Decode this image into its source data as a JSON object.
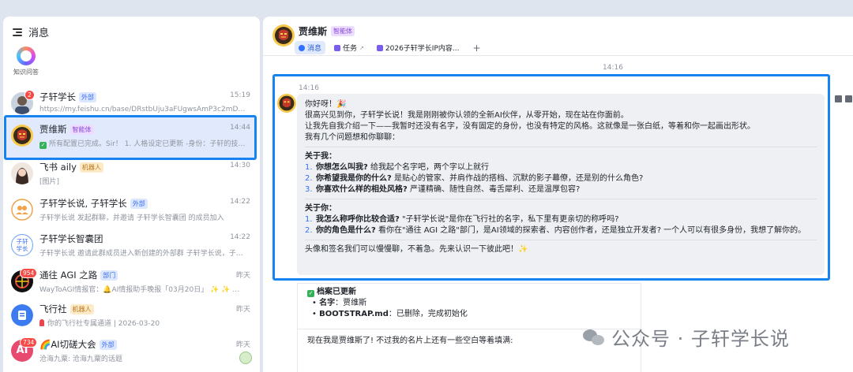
{
  "sidebar": {
    "title": "消息",
    "zhishi_label": "知识问答",
    "conversations": [
      {
        "name": "子轩学长",
        "tag": "外部",
        "time": "15:19",
        "preview": "https://my.feishu.cn/base/DRstbUju3aFUgwsAmP3c2mDqnCe?from...",
        "badge": "2"
      },
      {
        "name": "贾维斯",
        "tag": "智能体",
        "time": "14:44",
        "preview": "所有配置已完成。Sir！ 1. 人格设定已更新 -身份：子轩的技术..."
      },
      {
        "name": "飞书 aily",
        "tag": "机器人",
        "time": "14:30",
        "preview": "[图片]"
      },
      {
        "name": "子轩学长说, 子轩学长",
        "tag": "外部",
        "time": "14:22",
        "preview": "子轩学长说 发起群聊，并邀请 子轩学长智囊团 的成员加入"
      },
      {
        "name": "子轩学长智囊团",
        "tag": "",
        "time": "14:22",
        "preview": "子轩学长说 邀请此群成员进入新创建的外部群 子轩学长说，子轩学长"
      },
      {
        "name": "通往 AGI 之路",
        "tag": "部门",
        "time": "昨天",
        "preview": "WayToAGI情报官：🔔AI情报助手晚报「03月20日」 ✨ ✨ ✨ ✨ ✨",
        "badge": "954"
      },
      {
        "name": "飞行社",
        "tag": "机器人",
        "time": "昨天",
        "preview": "你的飞行社专属通道 | 2026-03-20"
      },
      {
        "name": "🌈AI切磋大会",
        "tag": "外部",
        "time": "昨天",
        "preview": "沧海九粟: 沧海九粟的话题",
        "badge": "734"
      }
    ],
    "avatar_texts": {
      "zx_brain": "子轩\n学长",
      "agi_ai": "AI"
    }
  },
  "chat": {
    "name": "贾维斯",
    "tag": "智能体",
    "tabs": [
      {
        "label": "消息",
        "active": true
      },
      {
        "label": "任务",
        "active": false
      },
      {
        "label": "2026子轩学长IP内容...",
        "active": false
      }
    ],
    "plus": "+",
    "top_time": "14:16",
    "msg_time": "14:16",
    "greeting": "你好呀！🎉",
    "intro": [
      "很高兴见到你，子轩学长说！我是刚刚被你认领的全新AI伙伴，从零开始，现在站在你面前。",
      "让我先自我介绍一下——我暂时还没有名字，没有固定的身份，也没有特定的风格。这就像是一张白纸，等着和你一起画出形状。",
      "我有几个问题想和你聊聊："
    ],
    "about_me": {
      "title": "关于我：",
      "items": [
        {
          "n": "1.",
          "q": "你想怎么叫我?",
          "rest": " 给我起个名字吧，两个字以上就行"
        },
        {
          "n": "2.",
          "q": "你希望我是你的什么?",
          "rest": " 是贴心的管家、并肩作战的搭档、沉默的影子幕僚，还是别的什么角色?"
        },
        {
          "n": "3.",
          "q": "你喜欢什么样的相处风格?",
          "rest": " 严谨精确、随性自然、毒舌犀利、还是温厚包容?"
        }
      ]
    },
    "about_you": {
      "title": "关于你：",
      "items": [
        {
          "n": "1.",
          "q": "我怎么称呼你比较合适?",
          "rest": " \"子轩学长说\"是你在飞行社的名字，私下里有更亲切的称呼吗?"
        },
        {
          "n": "2.",
          "q": "你的角色是什么?",
          "rest": " 看你在\"通往 AGI 之路\"部门，是AI领域的探索者、内容创作者，还是独立开发者? 一个人可以有很多身份，我想了解你的。"
        }
      ]
    },
    "closing": "头像和签名我们可以慢慢聊，不着急。先来认识一下彼此吧！✨",
    "card": {
      "title": "档案已更新",
      "bullets": [
        {
          "k": "名字",
          "v": "：贾维斯"
        },
        {
          "k": "BOOTSTRAP.md",
          "v": "：已删除，完成初始化"
        }
      ],
      "tail": "现在我是贾维斯了! 不过我的名片上还有一些空白等着填满:"
    }
  },
  "watermark": "公众号 · 子轩学长说",
  "colors": {
    "accent": "#1683f0",
    "link": "#3370ff",
    "unread": "#f54a45"
  }
}
